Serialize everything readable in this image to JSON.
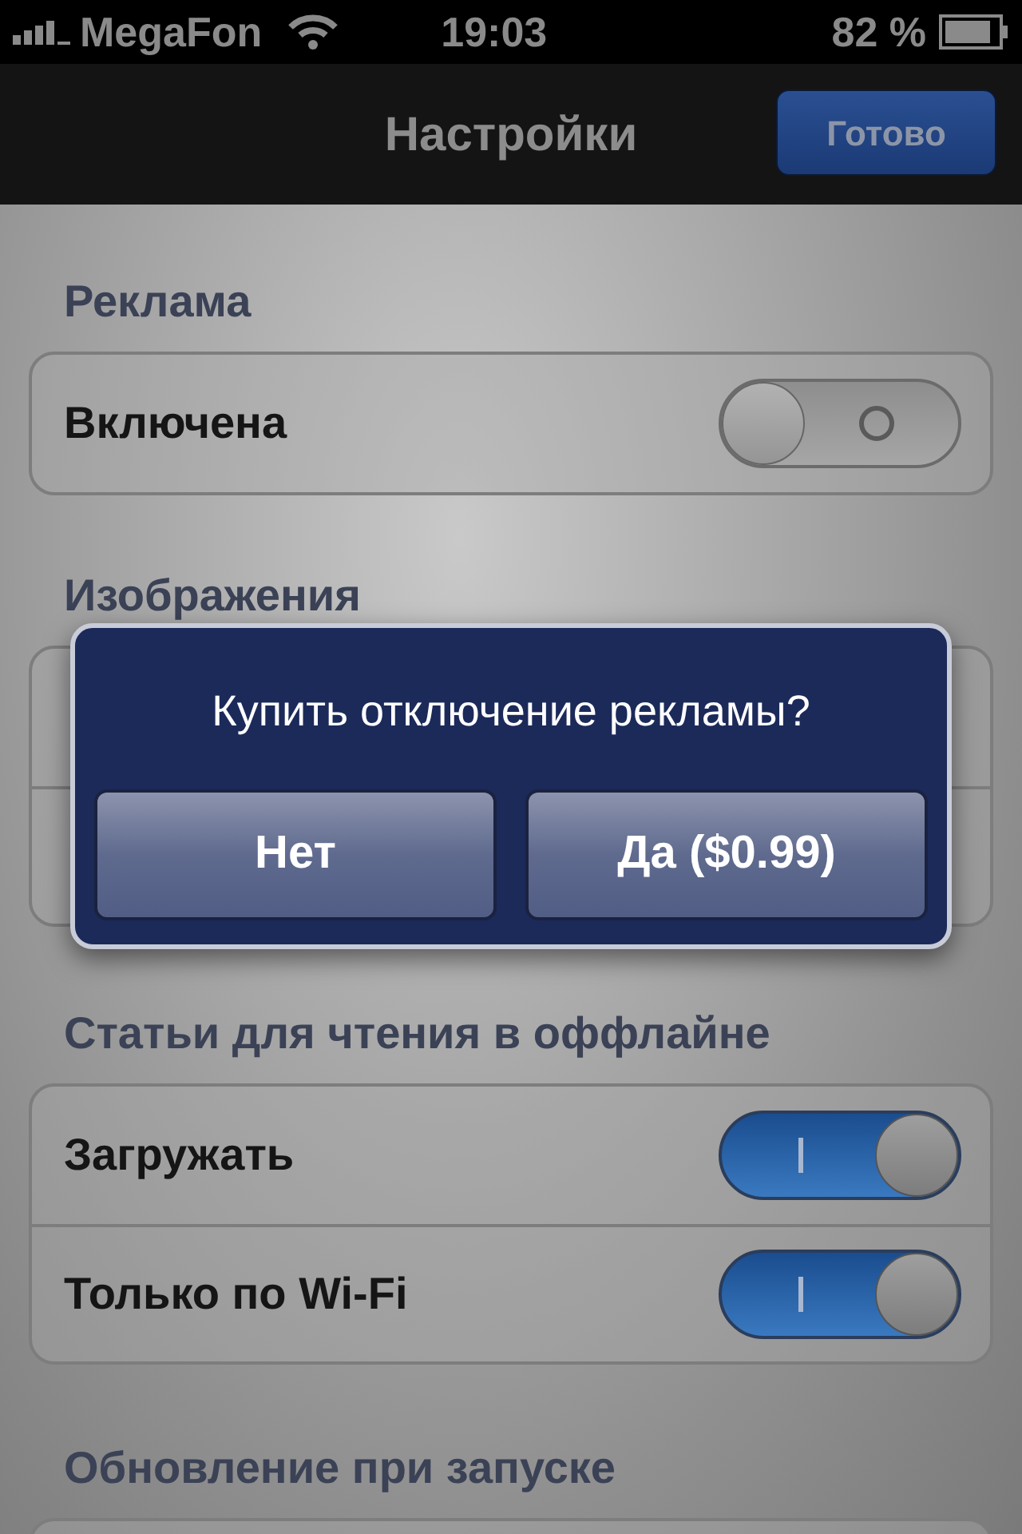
{
  "status_bar": {
    "carrier": "MegaFon",
    "time": "19:03",
    "battery": "82 %"
  },
  "nav_bar": {
    "title": "Настройки",
    "done_button": "Готово"
  },
  "sections": [
    {
      "header": "Реклама",
      "rows": [
        {
          "label": "Включена",
          "on": false
        }
      ]
    },
    {
      "header": "Изображения",
      "kind": "covered"
    },
    {
      "header": "Статьи для чтения в оффлайне",
      "rows": [
        {
          "label": "Загружать",
          "on": true
        },
        {
          "label": "Только по Wi-Fi",
          "on": true
        }
      ]
    },
    {
      "header": "Обновление при запуске",
      "kind": "cut_off"
    }
  ],
  "alert": {
    "message": "Купить отключение рекламы?",
    "buttons": [
      "Нет",
      "Да ($0.99)"
    ]
  }
}
